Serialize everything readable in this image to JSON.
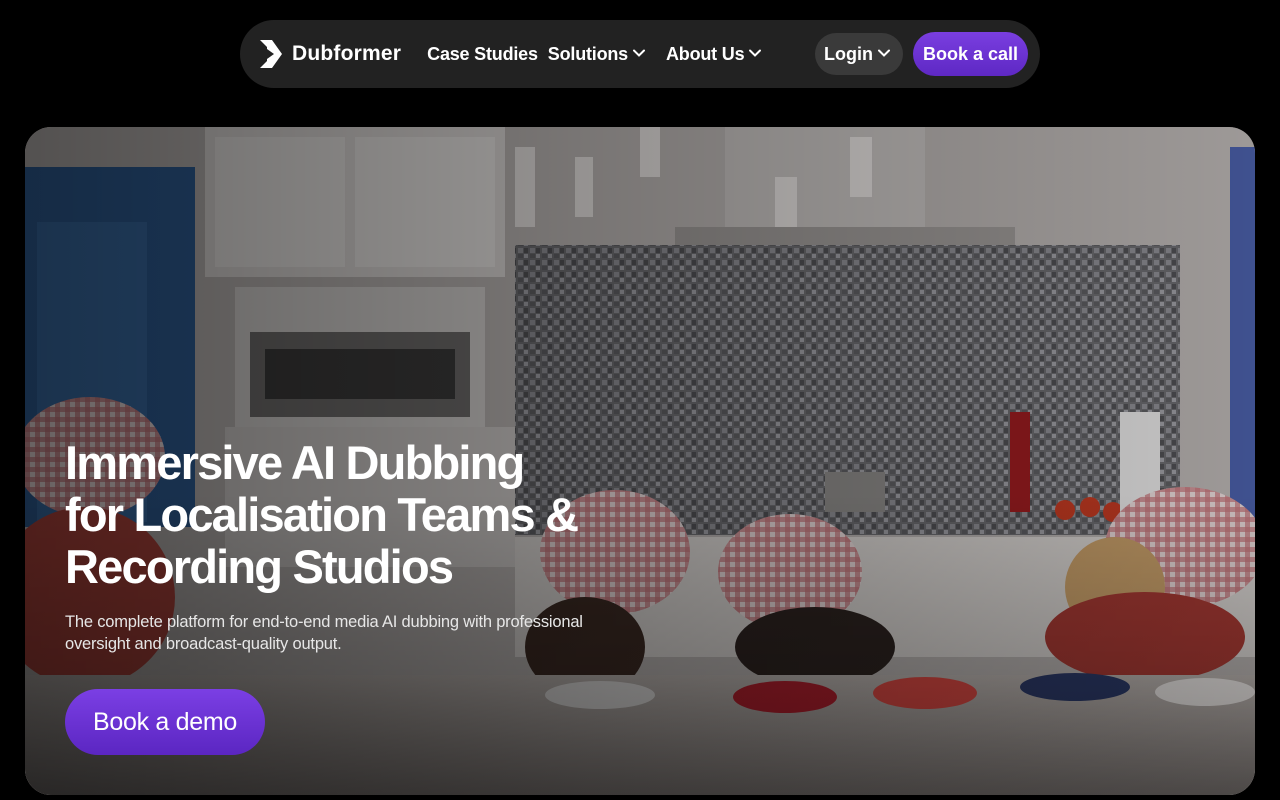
{
  "nav": {
    "brand": "Dubformer",
    "links": [
      {
        "label": "Case Studies",
        "dropdown": false
      },
      {
        "label": "Solutions",
        "dropdown": true
      },
      {
        "label": "About Us",
        "dropdown": true
      }
    ],
    "login_label": "Login",
    "book_call_label": "Book a call"
  },
  "hero": {
    "title_lines": [
      "Immersive AI Dubbing",
      "for Localisation Teams &",
      "Recording Studios"
    ],
    "subtitle": "The complete platform for end-to-end media AI dubbing with professional oversight and broadcast-quality output.",
    "cta_label": "Book a demo"
  },
  "colors": {
    "accent": "#6a30d6",
    "nav_bg": "#222222",
    "page_bg": "#000000"
  },
  "icons": [
    "dubformer-logo-icon",
    "chevron-down-icon"
  ]
}
